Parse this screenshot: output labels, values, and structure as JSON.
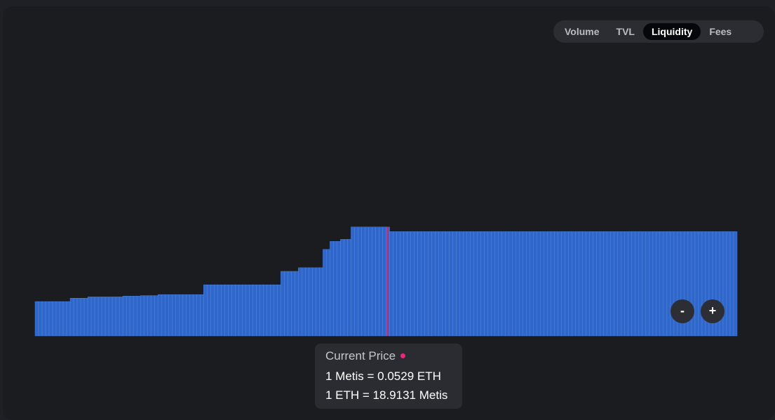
{
  "tabs": [
    {
      "label": "Volume",
      "active": false
    },
    {
      "label": "TVL",
      "active": false
    },
    {
      "label": "Liquidity",
      "active": true
    },
    {
      "label": "Fees",
      "active": false
    }
  ],
  "zoom": {
    "out_label": "-",
    "in_label": "+"
  },
  "tooltip": {
    "title": "Current Price",
    "line1": "1 Metis = 0.0529 ETH",
    "line2": "1 ETH = 18.9131 Metis"
  },
  "colors": {
    "bar": "#2f66c9",
    "bar_outline": "#5a8fe8",
    "current_price": "#e0226b",
    "tooltip_dot": "#f0257a"
  },
  "chart_data": {
    "type": "bar",
    "title": "",
    "xlabel": "",
    "ylabel": "",
    "grid": false,
    "ylim": [
      0,
      100
    ],
    "current_price_index": 100,
    "series": [
      {
        "values": [
          13.3,
          13.3,
          13.3,
          13.3,
          13.3,
          13.3,
          13.3,
          13.3,
          13.3,
          13.3,
          14.6,
          14.6,
          14.6,
          14.6,
          14.6,
          15.1,
          15.1,
          15.1,
          15.1,
          15.1,
          15.1,
          15.1,
          15.1,
          15.1,
          15.1,
          15.4,
          15.4,
          15.4,
          15.4,
          15.4,
          15.6,
          15.6,
          15.6,
          15.6,
          15.6,
          16.0,
          16.0,
          16.0,
          16.0,
          16.0,
          16.0,
          16.0,
          16.0,
          16.0,
          16.0,
          16.0,
          16.0,
          16.0,
          19.8,
          19.8,
          19.8,
          19.8,
          19.8,
          19.8,
          19.8,
          19.8,
          19.8,
          19.8,
          19.8,
          19.8,
          19.8,
          19.8,
          19.8,
          19.8,
          19.8,
          19.8,
          19.8,
          19.8,
          19.8,
          19.8,
          25.0,
          25.0,
          25.0,
          25.0,
          25.0,
          26.4,
          26.4,
          26.4,
          26.4,
          26.4,
          26.4,
          26.4,
          33.5,
          33.5,
          36.6,
          36.6,
          36.6,
          37.4,
          37.4,
          37.4,
          42.2,
          42.2,
          42.2,
          42.2,
          42.2,
          42.2,
          42.2,
          42.2,
          42.2,
          42.2,
          42.2,
          40.4,
          40.4,
          40.4,
          40.4,
          40.4,
          40.4,
          40.4,
          40.4,
          40.4,
          40.4,
          40.4,
          40.4,
          40.4,
          40.4,
          40.4,
          40.4,
          40.4,
          40.4,
          40.4,
          40.4,
          40.4,
          40.4,
          40.4,
          40.4,
          40.4,
          40.4,
          40.4,
          40.4,
          40.4,
          40.4,
          40.4,
          40.4,
          40.4,
          40.4,
          40.4,
          40.4,
          40.4,
          40.4,
          40.4,
          40.4,
          40.4,
          40.4,
          40.4,
          40.4,
          40.4,
          40.4,
          40.4,
          40.4,
          40.4,
          40.4,
          40.4,
          40.4,
          40.4,
          40.4,
          40.4,
          40.4,
          40.4,
          40.4,
          40.4,
          40.4,
          40.4,
          40.4,
          40.4,
          40.4,
          40.4,
          40.4,
          40.4,
          40.4,
          40.4,
          40.4,
          40.4,
          40.4,
          40.4,
          40.4,
          40.4,
          40.4,
          40.4,
          40.4,
          40.4,
          40.4,
          40.4,
          40.4,
          40.4,
          40.4,
          40.4,
          40.4,
          40.4,
          40.4,
          40.4,
          40.4,
          40.4,
          40.4,
          40.4,
          40.4,
          40.4,
          40.4,
          40.4,
          40.4,
          40.4
        ]
      }
    ]
  }
}
